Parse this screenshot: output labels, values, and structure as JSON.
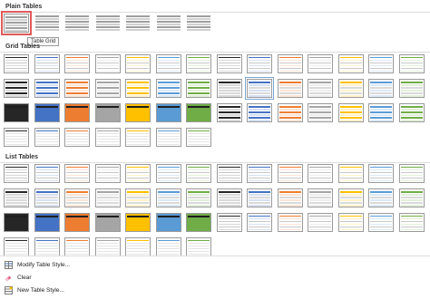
{
  "sections": {
    "plain": "Plain Tables",
    "grid": "Grid Tables",
    "list": "List Tables"
  },
  "tooltip": "Table Grid",
  "footer": {
    "modify": "Modify Table Style...",
    "clear": "Clear",
    "new": "New Table Style..."
  },
  "accents": {
    "black": "#262626",
    "blue": "#4472c4",
    "orange": "#ed7d31",
    "gray": "#a5a5a5",
    "gold": "#ffc000",
    "lightblue": "#5b9bd5",
    "green": "#70ad47"
  },
  "icons": {
    "modify": "modify-table-style-icon",
    "clear": "eraser-icon",
    "new": "new-table-style-icon"
  }
}
